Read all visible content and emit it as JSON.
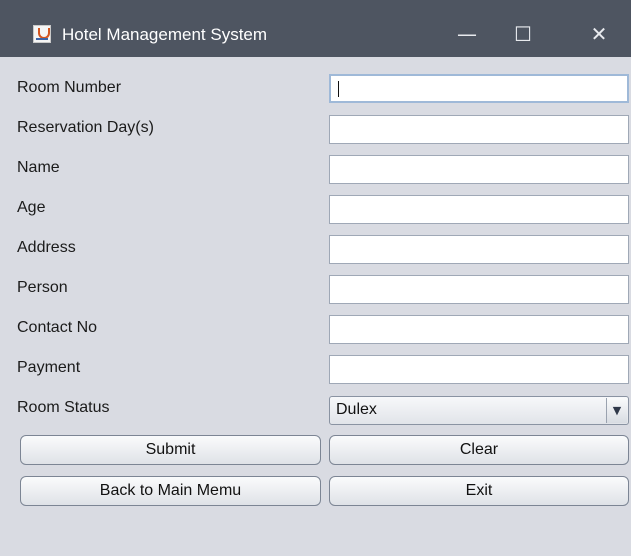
{
  "window": {
    "title": "Hotel Management System",
    "minimize_glyph": "—",
    "maximize_glyph": "☐",
    "close_glyph": "✕"
  },
  "form": {
    "labels": {
      "room_number": "Room Number",
      "reservation_days": "Reservation Day(s)",
      "name": "Name",
      "age": "Age",
      "address": "Address",
      "person": "Person",
      "contact_no": "Contact No",
      "payment": "Payment",
      "room_status": "Room Status"
    },
    "values": {
      "room_number": "",
      "reservation_days": "",
      "name": "",
      "age": "",
      "address": "",
      "person": "",
      "contact_no": "",
      "payment": ""
    },
    "room_status_selected": "Dulex",
    "combo_arrow_glyph": "▼"
  },
  "buttons": {
    "submit": "Submit",
    "clear": "Clear",
    "back": "Back to Main Memu",
    "exit": "Exit"
  }
}
